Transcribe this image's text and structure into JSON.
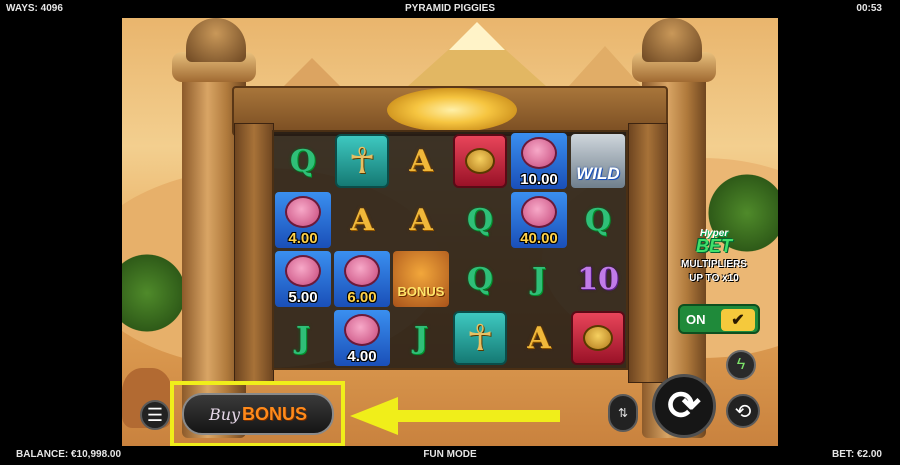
{
  "topbar": {
    "ways": "WAYS: 4096",
    "title": "PYRAMID PIGGIES",
    "clock": "00:53"
  },
  "bottombar": {
    "balance": "BALANCE: €10,998.00",
    "mode": "FUN MODE",
    "bet": "BET: €2.00"
  },
  "reels": {
    "symbols": {
      "q": "Q",
      "a": "A",
      "j": "J",
      "ten": "10",
      "ankh": "☥",
      "wild": "WILD",
      "bonus": "BONUS"
    },
    "multipliers": {
      "r1c5": "10.00",
      "r2c1": "4.00",
      "r2c5": "40.00",
      "r3c1": "5.00",
      "r3c2": "6.00",
      "r4c2": "4.00"
    }
  },
  "hyper_bet": {
    "line1": "Hyper",
    "line2": "BET",
    "line3": "MULTIPLIERS",
    "line4": "UP TO x10",
    "toggle_state": "ON",
    "toggle_check": "✔"
  },
  "buy_bonus": {
    "buy": "Buy",
    "bonus": "BONUS"
  },
  "icons": {
    "menu": "☰",
    "spin": "⟳",
    "autoplay": "⟲",
    "turbo": "ϟ",
    "stake": "⇅"
  },
  "colors": {
    "highlight": "#f0ee1a",
    "arrow": "#f0ee1a",
    "toggle_on": "#1f8a3a",
    "bonus_text": "#ff8a1a"
  }
}
